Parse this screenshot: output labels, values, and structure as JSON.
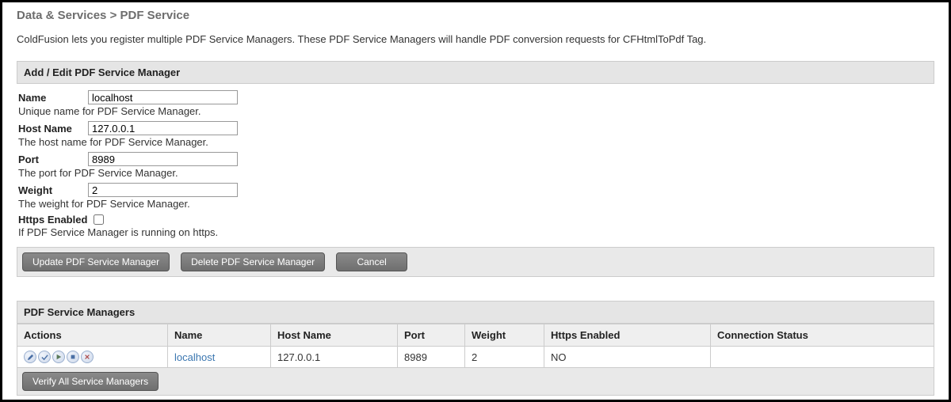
{
  "breadcrumb": "Data & Services > PDF Service",
  "description": "ColdFusion lets you register multiple PDF Service Managers. These PDF Service Managers will handle PDF conversion requests for CFHtmlToPdf Tag.",
  "form": {
    "header": "Add / Edit PDF Service Manager",
    "name": {
      "label": "Name",
      "value": "localhost",
      "help": "Unique name for PDF Service Manager."
    },
    "hostname": {
      "label": "Host Name",
      "value": "127.0.0.1",
      "help": "The host name for PDF Service Manager."
    },
    "port": {
      "label": "Port",
      "value": "8989",
      "help": "The port for PDF Service Manager."
    },
    "weight": {
      "label": "Weight",
      "value": "2",
      "help": "The weight for PDF Service Manager."
    },
    "https": {
      "label": "Https Enabled",
      "checked": false,
      "help": "If PDF Service Manager is running on https."
    }
  },
  "buttons": {
    "update": "Update PDF Service Manager",
    "delete": "Delete PDF Service Manager",
    "cancel": "Cancel",
    "verify_all": "Verify All Service Managers"
  },
  "list": {
    "header": "PDF Service Managers",
    "columns": {
      "actions": "Actions",
      "name": "Name",
      "hostname": "Host Name",
      "port": "Port",
      "weight": "Weight",
      "https": "Https Enabled",
      "status": "Connection Status"
    },
    "rows": [
      {
        "name": "localhost",
        "hostname": "127.0.0.1",
        "port": "8989",
        "weight": "2",
        "https": "NO",
        "status": ""
      }
    ]
  }
}
